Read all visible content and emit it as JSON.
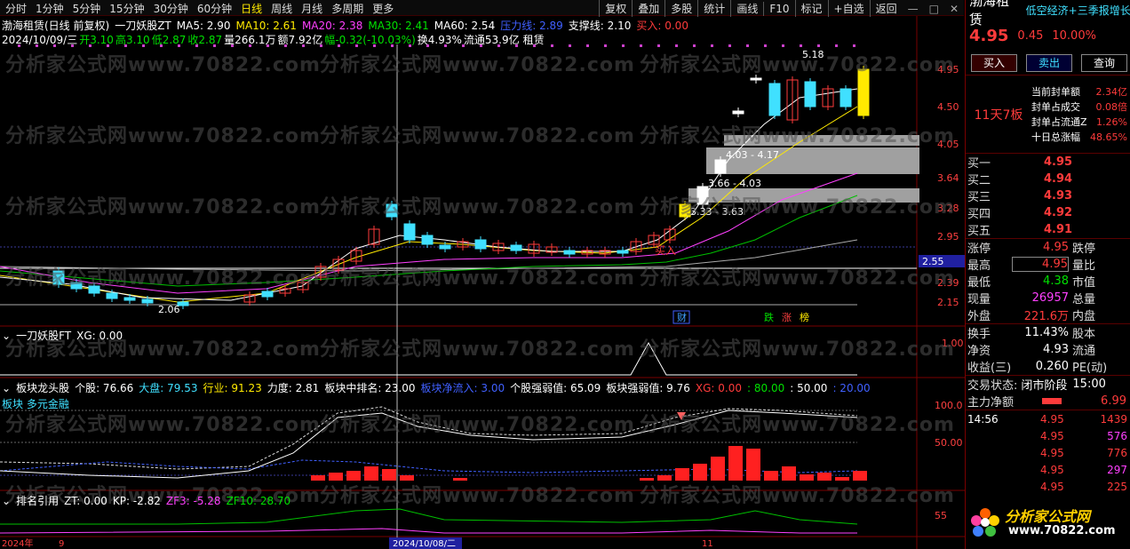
{
  "periods": [
    "分时",
    "1分钟",
    "5分钟",
    "15分钟",
    "30分钟",
    "60分钟",
    "日线",
    "周线",
    "月线",
    "多周期",
    "更多"
  ],
  "active_period": "日线",
  "toolbar": [
    "复权",
    "叠加",
    "多股",
    "统计",
    "画线",
    "F10",
    "标记",
    "+自选",
    "返回"
  ],
  "main": {
    "title": "渤海租赁(日线 前复权)",
    "indicator_name": "一刀妖股ZT",
    "ma5": "MA5: 2.90",
    "ma10": "MA10: 2.61",
    "ma20": "MA20: 2.38",
    "ma30": "MA30: 2.41",
    "ma60": "MA60: 2.54",
    "pressure": "压力线: 2.89",
    "support": "支撑线: 2.10",
    "buy_flag": "买入: 0.00",
    "date_line": "2024/10/09/三",
    "open": "开3.10",
    "high": "高3.10",
    "low": "低2.87",
    "close": "收2.87",
    "volume": "量266.1万",
    "amount": "额7.92亿",
    "change": "幅-0.32(-10.03%)",
    "turnover": "换4.93%",
    "float": "流通53.9亿",
    "sector": "租赁",
    "price_axis": [
      "4.95",
      "4.50",
      "4.05",
      "3.64",
      "3.28",
      "2.95",
      "2.55",
      "2.39",
      "2.15"
    ],
    "current_line_value": "2.55",
    "annotations": {
      "high_mark": "5.18",
      "low_mark": "2.06",
      "zone1": "4.03 - 4.17",
      "zone2": "3.66 - 4.03",
      "zone3": "3.33 - 3.63",
      "buy_text": "买入",
      "cai": "财",
      "die": "跌",
      "zhang": "涨",
      "bang": "榜"
    },
    "watermark": "分析家公式网www.70822.com"
  },
  "panel2": {
    "title": "一刀妖股FT",
    "xg": "XG: 0.00",
    "axis": [
      "1.00"
    ]
  },
  "panel3": {
    "title": "板块龙头股",
    "geogu": "个股: 76.66",
    "dapan": "大盘: 79.53",
    "hangye": "行业: 91.23",
    "lidu": "力度: 2.81",
    "paiming": "板块中排名: 23.00",
    "jingzhi": "板块净流入: 3.00",
    "gegu_qr": "个股强弱值: 65.09",
    "bankuai_qr": "板块强弱值: 9.76",
    "xg": "XG: 0.00",
    "v80": ": 80.00",
    "v50": ": 50.00",
    "v20": ": 20.00",
    "sector_label": "板块 多元金融",
    "axis": [
      "100.0",
      "50.00"
    ]
  },
  "panel4": {
    "title": "排名引用",
    "zt": "ZT: 0.00",
    "kp": "KP: -2.82",
    "zf3": "ZF3: -5.28",
    "zf10": "ZF10: 28.70",
    "axis": [
      "55"
    ]
  },
  "xaxis": [
    "2024年",
    "9",
    "2024/10/08/二",
    "11"
  ],
  "rpanel": {
    "stock_name": "渤海租赁",
    "ticker_scroll": "低空经济+三季报增长",
    "price": "4.95",
    "change": "0.45",
    "pct": "10.00%",
    "buy_btn": "买入",
    "sell_btn": "卖出",
    "query_btn": "查询",
    "limit_tag": "11天7板",
    "seal_info": [
      {
        "label": "当前封单额",
        "value": "2.34亿"
      },
      {
        "label": "封单占成交",
        "value": "0.08倍"
      },
      {
        "label": "封单占流通Z",
        "value": "1.26%"
      },
      {
        "label": "十日总涨幅",
        "value": "48.65%"
      }
    ],
    "orders": [
      {
        "label": "买一",
        "price": "4.95"
      },
      {
        "label": "买二",
        "price": "4.94"
      },
      {
        "label": "买三",
        "price": "4.93"
      },
      {
        "label": "买四",
        "price": "4.92"
      },
      {
        "label": "买五",
        "price": "4.91"
      }
    ],
    "stats": [
      {
        "l1": "涨停",
        "v1": "4.95",
        "l2": "跌停"
      },
      {
        "l1": "最高",
        "v1": "4.95",
        "l2": "量比"
      },
      {
        "l1": "最低",
        "v1": "4.38",
        "l2": "市值"
      },
      {
        "l1": "现量",
        "v1": "26957",
        "l2": "总量"
      },
      {
        "l1": "外盘",
        "v1": "221.6万",
        "l2": "内盘"
      }
    ],
    "stats2": [
      {
        "l1": "换手",
        "v1": "11.43%",
        "l2": "股本"
      },
      {
        "l1": "净资",
        "v1": "4.93",
        "l2": "流通"
      },
      {
        "l1": "收益(三)",
        "v1": "0.260",
        "l2": "PE(动)"
      }
    ],
    "trade_status_label": "交易状态:",
    "trade_status": "闭市阶段",
    "trade_time": "15:00",
    "main_flow_label": "主力净额",
    "main_flow": "6.99",
    "ticks": [
      {
        "time": "14:56",
        "price": "4.95",
        "vol": "1439"
      },
      {
        "time": "",
        "price": "4.95",
        "vol": "576"
      },
      {
        "time": "",
        "price": "4.95",
        "vol": "776"
      },
      {
        "time": "",
        "price": "4.95",
        "vol": "297"
      },
      {
        "time": "",
        "price": "4.95",
        "vol": "225"
      }
    ],
    "logo_text": "分析家公式网",
    "logo_url": "www.70822.com"
  },
  "colors": {
    "up": "#ff3b3b",
    "down": "#40e0ff",
    "ma5": "#ffffff",
    "ma10": "#ffea00",
    "ma20": "#ff40ff",
    "ma30": "#00e000",
    "ma60": "#aaaaaa"
  }
}
